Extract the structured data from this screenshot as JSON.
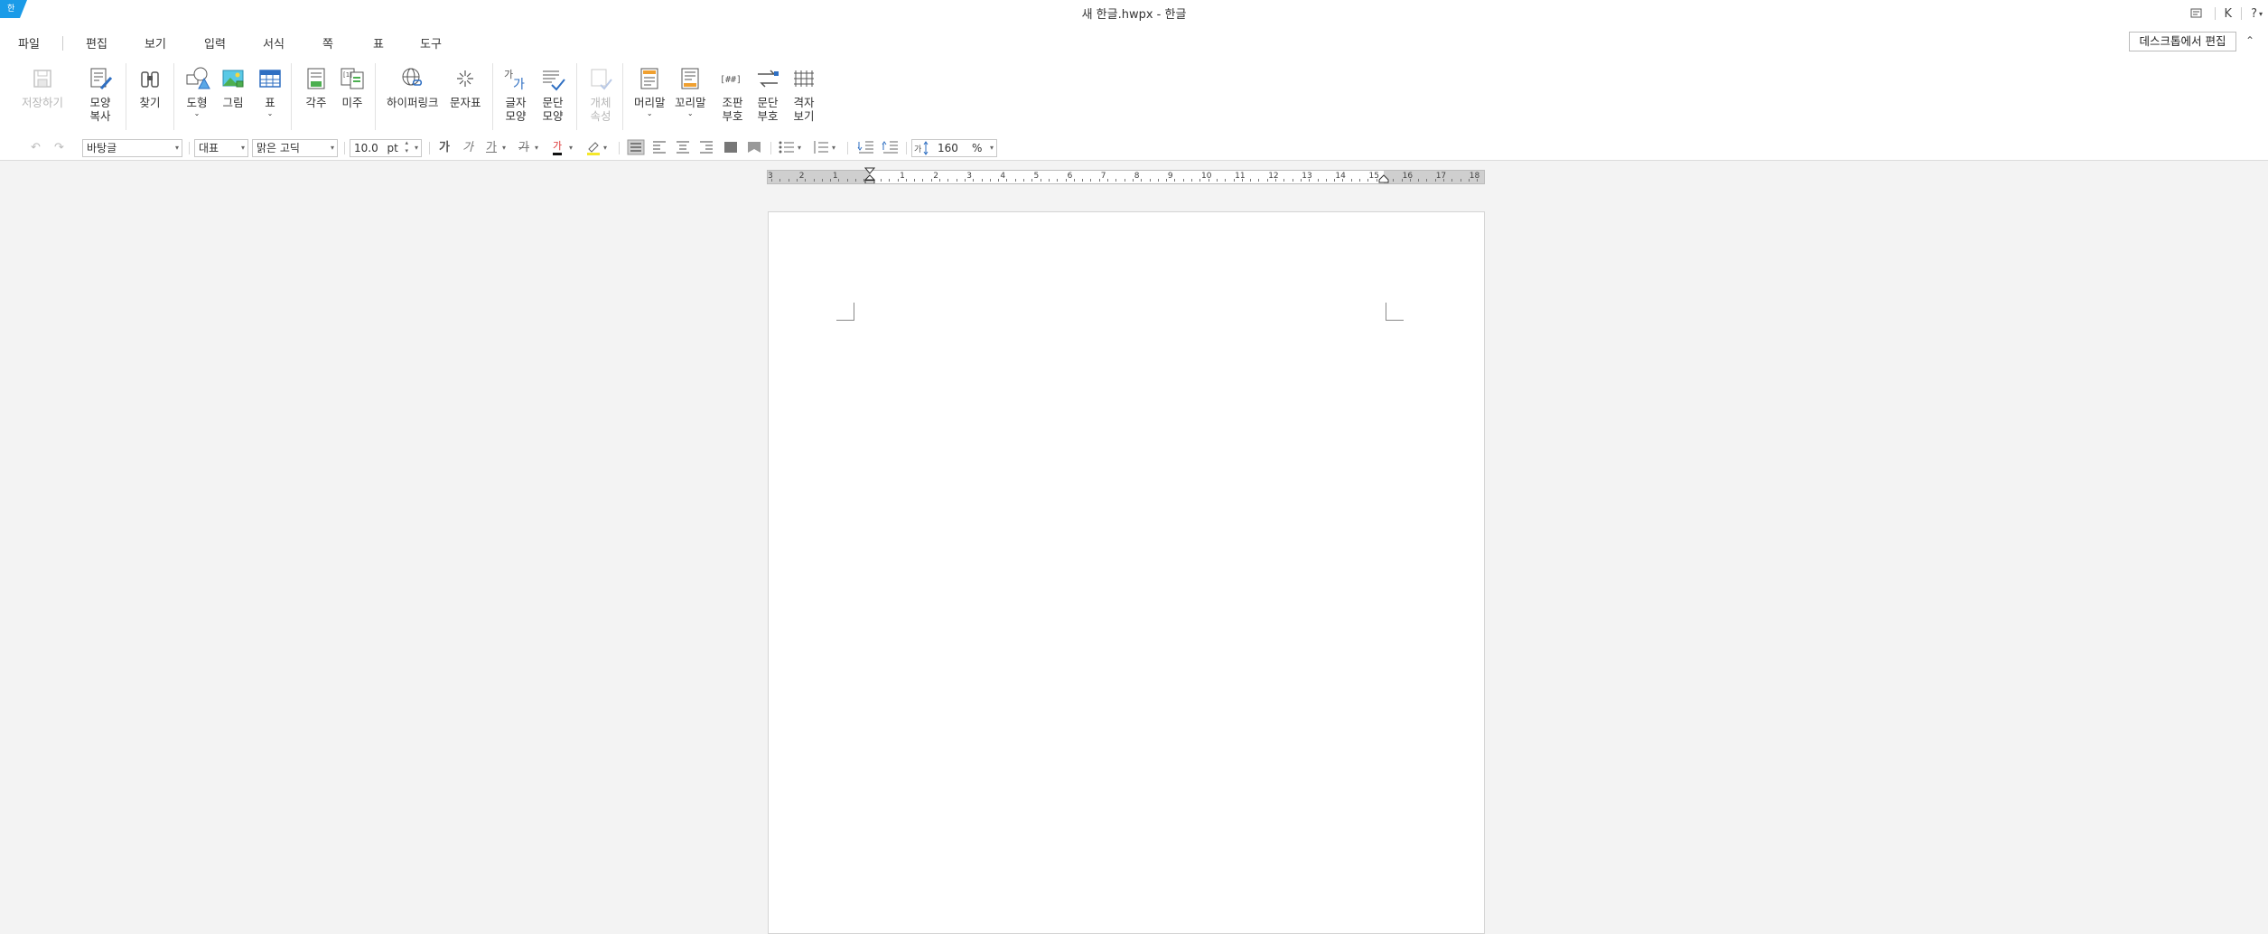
{
  "window": {
    "title": "새 한글.hwpx - 한글",
    "right_letter": "K",
    "help": "?"
  },
  "menu": [
    "파일",
    "편집",
    "보기",
    "입력",
    "서식",
    "쪽",
    "표",
    "도구"
  ],
  "desktop_edit_button": "데스크톱에서 편집",
  "ribbon": {
    "save": "저장하기",
    "format_copy": [
      "모양",
      "복사"
    ],
    "find": "찾기",
    "shape": "도형",
    "picture": "그림",
    "table": "표",
    "footnote": "각주",
    "endnote": "미주",
    "hyperlink": "하이퍼링크",
    "symbol": "문자표",
    "char_shape": [
      "글자",
      "모양"
    ],
    "para_shape": [
      "문단",
      "모양"
    ],
    "object_props": [
      "개체",
      "속성"
    ],
    "header": "머리말",
    "footer": "꼬리말",
    "compose": [
      "조판",
      "부호"
    ],
    "para_mark": [
      "문단",
      "부호"
    ],
    "grid_view": [
      "격자",
      "보기"
    ]
  },
  "format_bar": {
    "style": "바탕글",
    "lang": "대표",
    "font": "맑은 고딕",
    "font_size": "10.0",
    "size_unit": "pt",
    "line_spacing": "160",
    "line_spacing_unit": "%",
    "bold": "가",
    "italic": "가",
    "underline": "가",
    "strike": "가",
    "font_color": "가"
  },
  "ruler": {
    "labels": [
      "3",
      "2",
      "1",
      "1",
      "2",
      "3",
      "4",
      "5",
      "6",
      "7",
      "8",
      "9",
      "10",
      "11",
      "12",
      "13",
      "14",
      "15",
      "16",
      "17",
      "18"
    ]
  },
  "colors": {
    "accent": "#1a9be8",
    "blue_icon": "#2f6fc2",
    "teal": "#26a9a1",
    "orange": "#f0a030"
  }
}
